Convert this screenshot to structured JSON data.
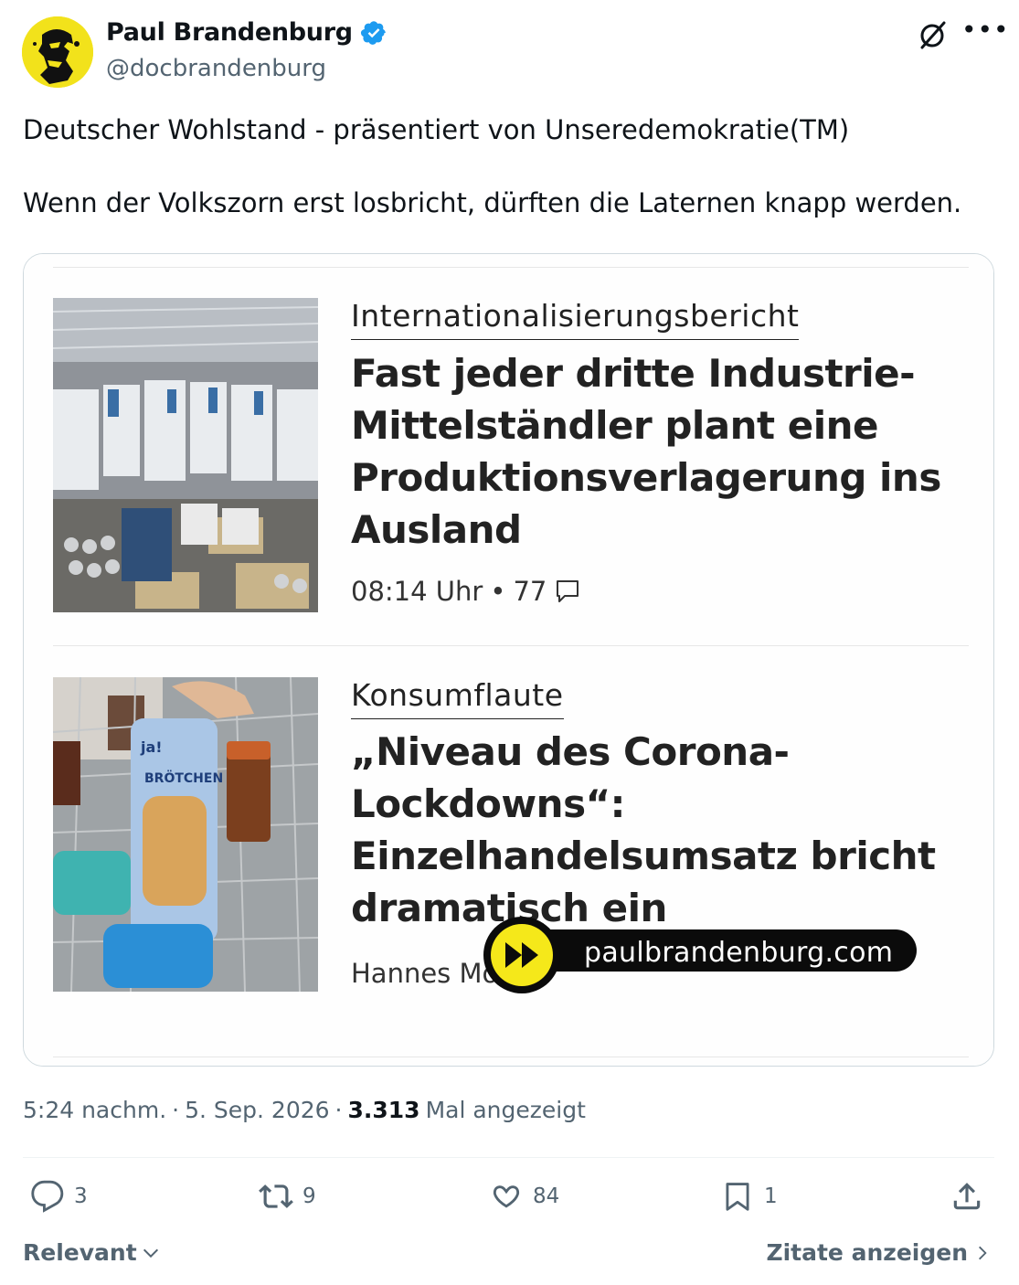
{
  "author": {
    "name": "Paul Brandenburg",
    "handle": "@docbrandenburg",
    "verified_color": "#1d9bf0",
    "avatar_bg": "#f2e21b"
  },
  "tweet": {
    "text": "Deutscher Wohlstand - präsentiert von Unseredemokratie(TM)\n\nWenn der Volkszorn erst losbricht, dürften die Laternen knapp werden."
  },
  "media": {
    "articles": [
      {
        "kicker": "Internationalisierungsbericht",
        "headline": "Fast jeder dritte Industrie-Mittelständler plant eine Produktionsverlagerung ins Ausland",
        "time": "08:14 Uhr",
        "comments": "77"
      },
      {
        "kicker": "Konsumflaute",
        "headline": "„Niveau des Corona-Lockdowns“: Einzelhandelsumsatz bricht dramatisch ein",
        "author_partial": "Hannes Mo"
      }
    ],
    "watermark": "paulbrandenburg.com",
    "product_label": "BRÖTCHEN",
    "product_brand": "ja!"
  },
  "footer": {
    "time": "5:24 nachm.",
    "date": "5. Sep. 2026",
    "views": "3.313",
    "views_label": "Mal angezeigt",
    "replies": "3",
    "reposts": "9",
    "likes": "84",
    "bookmarks": "1",
    "relevant": "Relevant",
    "quotes": "Zitate anzeigen"
  },
  "icons": {
    "reply": "reply-icon",
    "repost": "repost-icon",
    "like": "heart-icon",
    "bookmark": "bookmark-icon",
    "share": "share-icon",
    "grok": "grok-icon",
    "more": "more-icon"
  }
}
